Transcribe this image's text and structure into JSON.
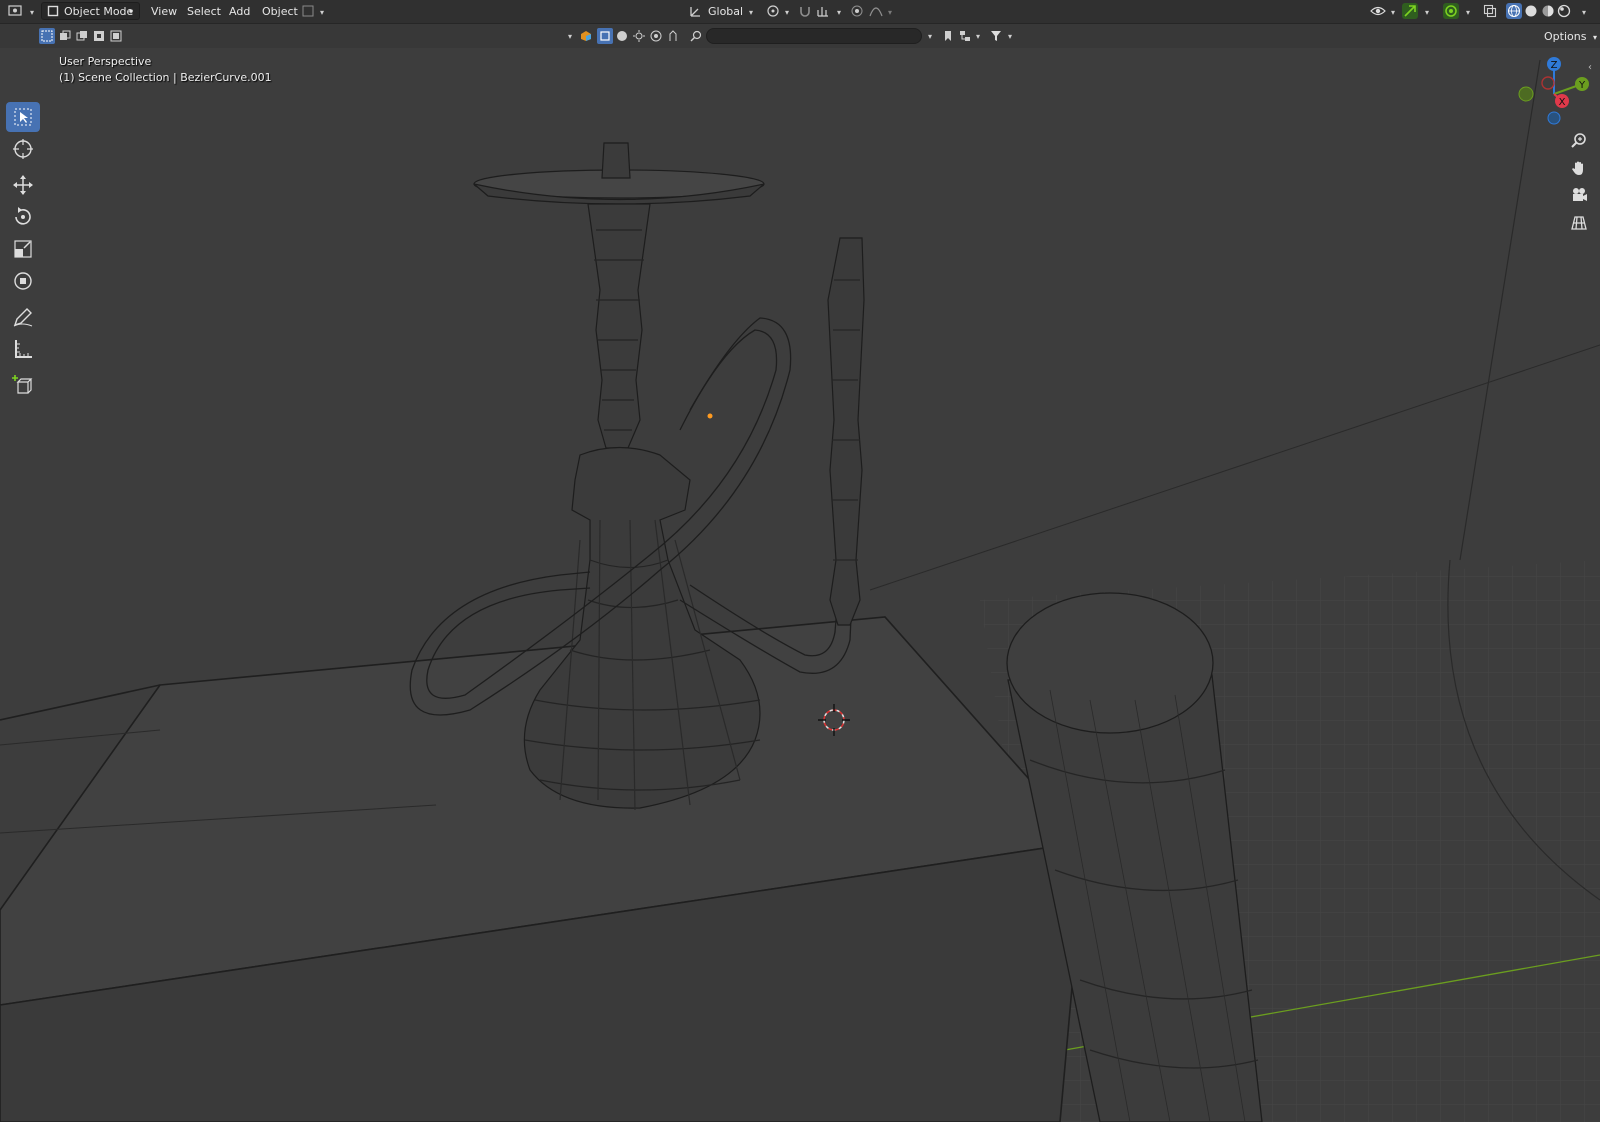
{
  "header": {
    "mode_label": "Object Mode",
    "menus": [
      "View",
      "Select",
      "Add",
      "Object"
    ],
    "transform_orientation": "Global",
    "options_label": "Options"
  },
  "search": {
    "placeholder": ""
  },
  "viewport": {
    "perspective_label": "User Perspective",
    "collection_label": "(1) Scene Collection | BezierCurve.001"
  },
  "gizmo": {
    "z": "Z",
    "y": "Y",
    "x": "X"
  },
  "colors": {
    "accent": "#4772b3",
    "axis_x": "#e0394a",
    "axis_y": "#6b9e1f",
    "axis_z": "#2f7ad9",
    "selected_origin": "#ff9b20"
  }
}
